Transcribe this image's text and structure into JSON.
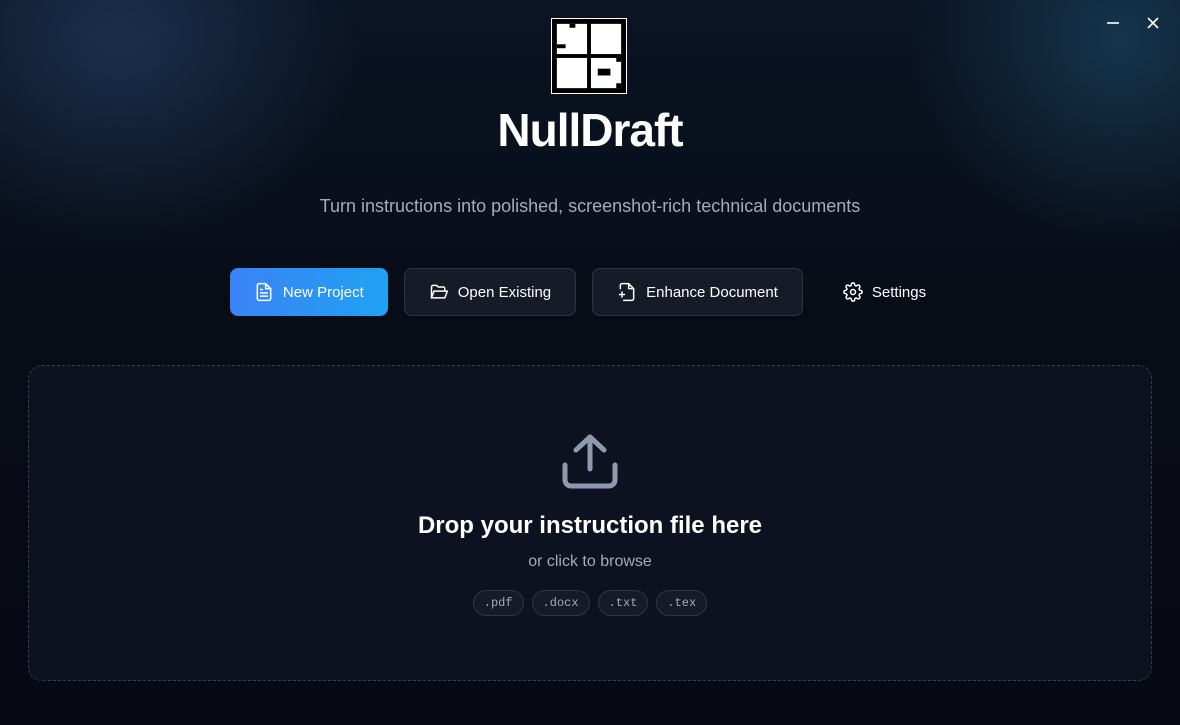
{
  "app": {
    "name": "NullDraft",
    "tagline": "Turn instructions into polished, screenshot-rich technical documents"
  },
  "window_controls": {
    "minimize_icon": "minus-icon",
    "close_icon": "x-icon"
  },
  "actions": {
    "new_project": {
      "label": "New Project",
      "icon": "file-text-icon"
    },
    "open_existing": {
      "label": "Open Existing",
      "icon": "folder-open-icon"
    },
    "enhance_document": {
      "label": "Enhance Document",
      "icon": "file-plus-icon"
    },
    "settings": {
      "label": "Settings",
      "icon": "gear-icon"
    }
  },
  "dropzone": {
    "icon": "upload-icon",
    "title": "Drop your instruction file here",
    "subtitle": "or click to browse",
    "file_types": [
      ".pdf",
      ".docx",
      ".txt",
      ".tex"
    ]
  },
  "colors": {
    "accent_start": "#3b82f6",
    "accent_end": "#1fa2f2",
    "muted_text": "#a3acbd",
    "panel": "#0e1220"
  }
}
